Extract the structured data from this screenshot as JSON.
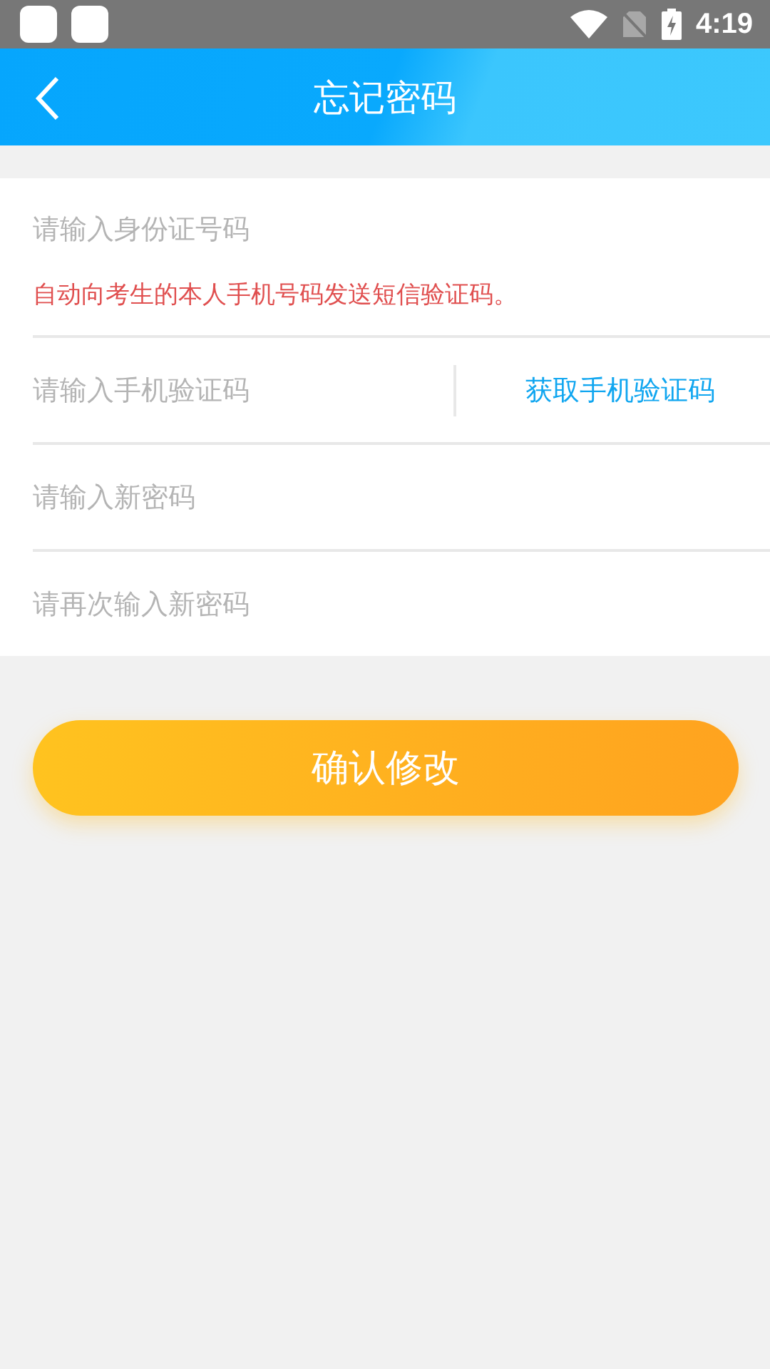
{
  "status_bar": {
    "time": "4:19"
  },
  "header": {
    "title": "忘记密码"
  },
  "id_field": {
    "placeholder": "请输入身份证号码"
  },
  "note": "自动向考生的本人手机号码发送短信验证码。",
  "code_field": {
    "placeholder": "请输入手机验证码",
    "button": "获取手机验证码"
  },
  "password_fields": [
    {
      "placeholder": "请输入新密码"
    },
    {
      "placeholder": "请再次输入新密码"
    }
  ],
  "submit_button": "确认修改"
}
